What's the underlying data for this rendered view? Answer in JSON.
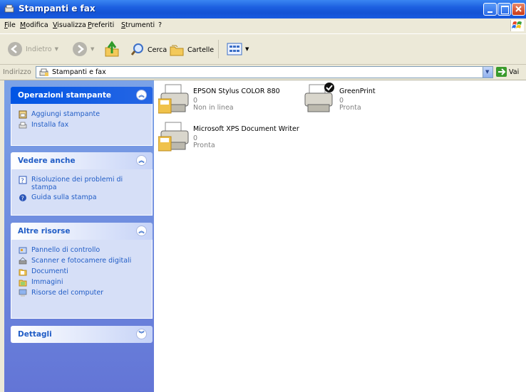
{
  "window": {
    "title": "Stampanti e fax"
  },
  "menu": [
    "File",
    "Modifica",
    "Visualizza",
    "Preferiti",
    "Strumenti",
    "?"
  ],
  "toolbar": {
    "back_label": "Indietro",
    "search_label": "Cerca",
    "folders_label": "Cartelle"
  },
  "address": {
    "label": "Indirizzo",
    "value": "Stampanti e fax",
    "go_label": "Vai"
  },
  "sidebar": {
    "printer_tasks": {
      "title": "Operazioni stampante",
      "items": [
        "Aggiungi stampante",
        "Installa fax"
      ]
    },
    "see_also": {
      "title": "Vedere anche",
      "items": [
        "Risoluzione dei problemi di stampa",
        "Guida sulla stampa"
      ]
    },
    "other_places": {
      "title": "Altre risorse",
      "items": [
        "Pannello di controllo",
        "Scanner e fotocamere digitali",
        "Documenti",
        "Immagini",
        "Risorse del computer"
      ]
    },
    "details": {
      "title": "Dettagli"
    }
  },
  "printers": [
    {
      "name": "EPSON Stylus COLOR 880",
      "docs": "0",
      "status": "Non in linea"
    },
    {
      "name": "GreenPrint",
      "docs": "0",
      "status": "Pronta"
    },
    {
      "name": "Microsoft XPS Document Writer",
      "docs": "0",
      "status": "Pronta"
    }
  ],
  "colors": {
    "titlebar": "#1553d4",
    "link": "#215dc6",
    "panel_bg": "#d6dff7",
    "sidebar_bg": "#6f8ee0"
  }
}
